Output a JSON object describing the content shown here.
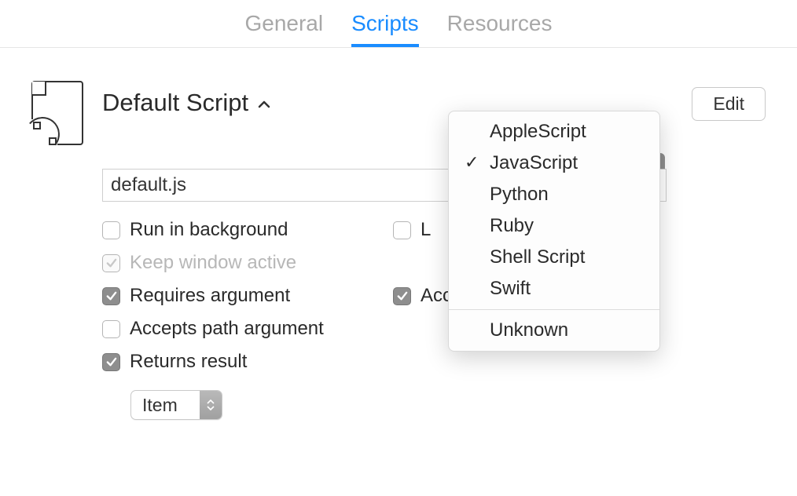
{
  "tabs": {
    "general": "General",
    "scripts": "Scripts",
    "resources": "Resources"
  },
  "header": {
    "title": "Default Script",
    "edit": "Edit"
  },
  "filename": "default.js",
  "options": {
    "run_bg": "Run in background",
    "keep_window": "Keep window active",
    "requires_arg": "Requires argument",
    "accepts_string": "Accepts string argument",
    "accepts_path": "Accepts path argument",
    "returns_result": "Returns result",
    "partial_right": "L"
  },
  "select": {
    "value": "Item"
  },
  "dropdown": {
    "items": [
      "AppleScript",
      "JavaScript",
      "Python",
      "Ruby",
      "Shell Script",
      "Swift"
    ],
    "extra": "Unknown",
    "selected": "JavaScript"
  }
}
